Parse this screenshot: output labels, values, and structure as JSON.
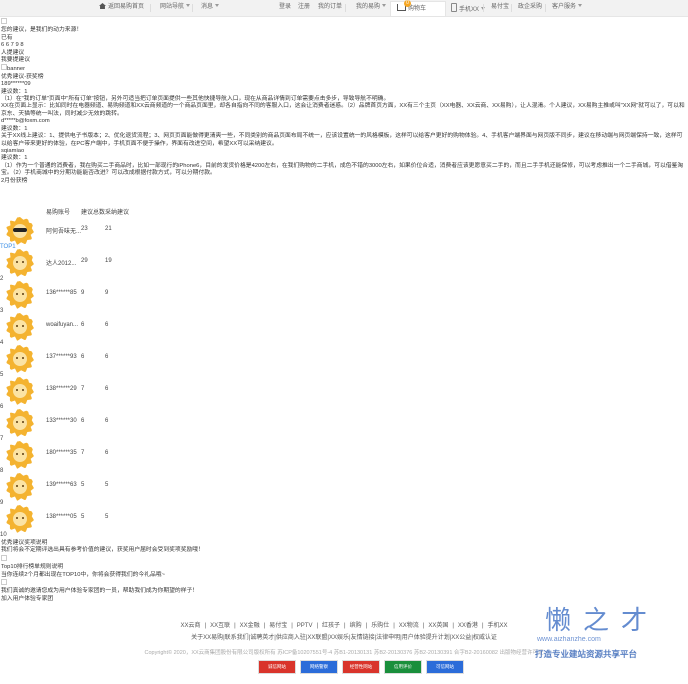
{
  "topbar": {
    "home": "返回易购首页",
    "nav": "网站导航",
    "msg": "消息",
    "login": "登录",
    "register": "注册",
    "orders": "我的订单",
    "my": "我的易购",
    "cart": "购物车",
    "cart_count": "0",
    "phone": "手机XX",
    "yifubao": "易付宝",
    "enterprise": "政企采购",
    "service": "客户服务"
  },
  "content": {
    "l1": "您的建议，是我们的动力来源！",
    "l2": "已有",
    "l3": "6 6 7 9 8",
    "l4": "人提建议",
    "l5": "我要提建议",
    "banner_alt": "banner",
    "l6": "优秀建议-获奖榜",
    "l7": "189******09",
    "l8": "建议数：1",
    "l9": "（1）在\"我的订单\"页面中\"所有订单\"按钮，另外可适当把订单页面提供一些其他快捷导航入口，现在从商品详情到订单需要点击多步，导致导航不明确。",
    "l10": "XX在页面上显示：比如同时在电器频道、易购频道和XX云商频道的一个商品页面里，却各自指向不同的客服入口，这会让消费者迷惑。（2）品牌首页方面，XX有三个主页（XX电器、XX云商、XX易购），让人混淆。个人建议，XX易购主推或叫\"XX网\"就可以了，可以和京东、天猫等统一叫法，同时减少无效的跳转。",
    "l11": "d*****b@foxm.com",
    "l12": "建议数：1",
    "l13": "关于XX线上建议：1、提供电子书版本；2、优化退货流程；3、网页页面能做得更清爽一些，不同类别的商品页面布局不统一，应该设置统一的风格模板，这样可以给客户更好的购物体验。4、手机客户端界面与网页版不同步，建议在移动端与网页端保持一致，这样可以给客户带来更好的体验，在PC客户端中，手机页面不便于操作，界面有改进空间，希望XX可以采纳建议。",
    "l14": "sqiamiao",
    "l15": "建议数：1",
    "l16": "（1）作为一个普通的消费者，我在购买二手商品时，比如一部现行的iPhone6，目前的发货价格是4200左右，在我们购物的二手机，成色不错的3000左右，如果价位合适，消费者应该更愿意买二手的，而且二手手机还能保修，可以考虑推出一个二手商城，可以借鉴淘宝。（2）手机商城中的分期功能能否改进？可以改成根据付款方式，可以分期付款。",
    "l17": "2月份获榜",
    "rank_col1": "易购账号",
    "rank_col2": "建议总数",
    "rank_col3": "采纳建议",
    "after1": "优秀建议奖项说明",
    "after2": "我们将会不定期评选出具有参考价值的建议，获奖用户届时会受到奖项奖励哦！",
    "after3": "Top10排行榜单规则说明",
    "after4": "当你连续2个月都出现在TOP10中，你将会获得我们的今礼品哦~",
    "after5": "我们真诚的邀请您成为用户体验专家团的一员，帮助我们成为你期望的样子！",
    "after6": "加入用户体验专家团"
  },
  "rank": [
    {
      "idx": "TOP1",
      "name": "阿何吾味无...",
      "n1": "23",
      "n2": "21",
      "glasses": true
    },
    {
      "idx": "2",
      "name": "达人2012...",
      "n1": "29",
      "n2": "19",
      "glasses": false
    },
    {
      "idx": "3",
      "name": "136******85",
      "n1": "9",
      "n2": "9",
      "glasses": false
    },
    {
      "idx": "4",
      "name": "woaifuyan...",
      "n1": "6",
      "n2": "6",
      "glasses": false
    },
    {
      "idx": "5",
      "name": "137******93",
      "n1": "6",
      "n2": "6",
      "glasses": false
    },
    {
      "idx": "6",
      "name": "138******29",
      "n1": "7",
      "n2": "6",
      "glasses": false
    },
    {
      "idx": "7",
      "name": "133******30",
      "n1": "6",
      "n2": "6",
      "glasses": false
    },
    {
      "idx": "8",
      "name": "180******35",
      "n1": "7",
      "n2": "6",
      "glasses": false
    },
    {
      "idx": "9",
      "name": "139******63",
      "n1": "5",
      "n2": "5",
      "glasses": false
    },
    {
      "idx": "10",
      "name": "138******05",
      "n1": "5",
      "n2": "5",
      "glasses": false
    }
  ],
  "footer": {
    "links1": [
      "XX云商",
      "XX互联",
      "XX金融",
      "易付宝",
      "PPTV",
      "红孩子",
      "缤购",
      "乐购仕",
      "XX物流",
      "XX英国",
      "XX香港",
      "手机XX"
    ],
    "links2": [
      "关于XX易购",
      "联系我们",
      "诚聘英才",
      "供应商入驻",
      "XX联盟",
      "XX娱乐",
      "友情链接",
      "法律申明",
      "用户体验提升计划",
      "XX公益",
      "权威认证"
    ],
    "copyright": "Copyright© 2020，XX云商集团股份有限公司版权所有 苏ICP备10207551号-4 苏B1-20130131 苏B2-20130376 苏B2-20130391 合字B2-20160082 出版物经营许可证",
    "badges": [
      "诚信网站",
      "网络警察",
      "经营性网站",
      "信用评价",
      "可信网站"
    ]
  },
  "watermark": {
    "title": "懒之才",
    "url": "www.aizhanzhe.com",
    "slogan": "打造专业建站资源共享平台"
  }
}
